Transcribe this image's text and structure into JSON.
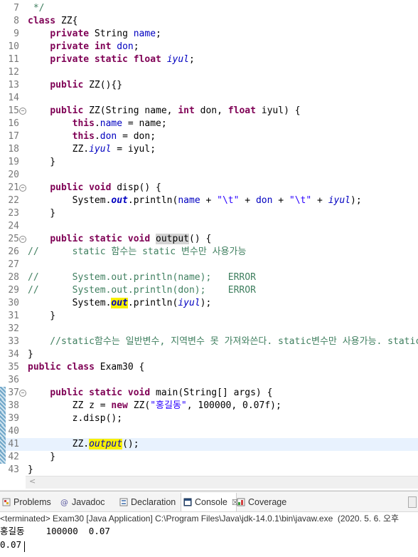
{
  "editor": {
    "lines": [
      {
        "num": "7",
        "fold": false,
        "mark": false,
        "hl": false,
        "segs": [
          {
            "t": " */",
            "c": "cmt"
          }
        ]
      },
      {
        "num": "8",
        "fold": false,
        "mark": false,
        "hl": false,
        "segs": [
          {
            "t": "class",
            "c": "kw"
          },
          {
            "t": " ZZ{"
          }
        ]
      },
      {
        "num": "9",
        "fold": false,
        "mark": false,
        "hl": false,
        "segs": [
          {
            "t": "    "
          },
          {
            "t": "private",
            "c": "kw"
          },
          {
            "t": " String "
          },
          {
            "t": "name",
            "c": "fld"
          },
          {
            "t": ";"
          }
        ]
      },
      {
        "num": "10",
        "fold": false,
        "mark": false,
        "hl": false,
        "segs": [
          {
            "t": "    "
          },
          {
            "t": "private",
            "c": "kw"
          },
          {
            "t": " "
          },
          {
            "t": "int",
            "c": "kw"
          },
          {
            "t": " "
          },
          {
            "t": "don",
            "c": "fld"
          },
          {
            "t": ";"
          }
        ]
      },
      {
        "num": "11",
        "fold": false,
        "mark": false,
        "hl": false,
        "segs": [
          {
            "t": "    "
          },
          {
            "t": "private static float",
            "c": "kw"
          },
          {
            "t": " "
          },
          {
            "t": "iyul",
            "c": "sfl"
          },
          {
            "t": ";"
          }
        ]
      },
      {
        "num": "12",
        "fold": false,
        "mark": false,
        "hl": false,
        "segs": []
      },
      {
        "num": "13",
        "fold": false,
        "mark": false,
        "hl": false,
        "segs": [
          {
            "t": "    "
          },
          {
            "t": "public",
            "c": "kw"
          },
          {
            "t": " ZZ(){}"
          }
        ]
      },
      {
        "num": "14",
        "fold": false,
        "mark": false,
        "hl": false,
        "segs": []
      },
      {
        "num": "15",
        "fold": true,
        "mark": false,
        "hl": false,
        "segs": [
          {
            "t": "    "
          },
          {
            "t": "public",
            "c": "kw"
          },
          {
            "t": " ZZ(String name, "
          },
          {
            "t": "int",
            "c": "kw"
          },
          {
            "t": " don, "
          },
          {
            "t": "float",
            "c": "kw"
          },
          {
            "t": " iyul) {"
          }
        ]
      },
      {
        "num": "16",
        "fold": false,
        "mark": false,
        "hl": false,
        "segs": [
          {
            "t": "        "
          },
          {
            "t": "this",
            "c": "kw"
          },
          {
            "t": "."
          },
          {
            "t": "name",
            "c": "fld"
          },
          {
            "t": " = name;"
          }
        ]
      },
      {
        "num": "17",
        "fold": false,
        "mark": false,
        "hl": false,
        "segs": [
          {
            "t": "        "
          },
          {
            "t": "this",
            "c": "kw"
          },
          {
            "t": "."
          },
          {
            "t": "don",
            "c": "fld"
          },
          {
            "t": " = don;"
          }
        ]
      },
      {
        "num": "18",
        "fold": false,
        "mark": false,
        "hl": false,
        "segs": [
          {
            "t": "        ZZ."
          },
          {
            "t": "iyul",
            "c": "sfl"
          },
          {
            "t": " = iyul;"
          }
        ]
      },
      {
        "num": "19",
        "fold": false,
        "mark": false,
        "hl": false,
        "segs": [
          {
            "t": "    }"
          }
        ]
      },
      {
        "num": "20",
        "fold": false,
        "mark": false,
        "hl": false,
        "segs": []
      },
      {
        "num": "21",
        "fold": true,
        "mark": false,
        "hl": false,
        "segs": [
          {
            "t": "    "
          },
          {
            "t": "public void",
            "c": "kw"
          },
          {
            "t": " disp() {"
          }
        ]
      },
      {
        "num": "22",
        "fold": false,
        "mark": false,
        "hl": false,
        "segs": [
          {
            "t": "        System."
          },
          {
            "t": "out",
            "c": "out"
          },
          {
            "t": ".println("
          },
          {
            "t": "name",
            "c": "fld"
          },
          {
            "t": " + "
          },
          {
            "t": "\"\\t\"",
            "c": "str"
          },
          {
            "t": " + "
          },
          {
            "t": "don",
            "c": "fld"
          },
          {
            "t": " + "
          },
          {
            "t": "\"\\t\"",
            "c": "str"
          },
          {
            "t": " + "
          },
          {
            "t": "iyul",
            "c": "sfl"
          },
          {
            "t": ");"
          }
        ]
      },
      {
        "num": "23",
        "fold": false,
        "mark": false,
        "hl": false,
        "segs": [
          {
            "t": "    }"
          }
        ]
      },
      {
        "num": "24",
        "fold": false,
        "mark": false,
        "hl": false,
        "segs": []
      },
      {
        "num": "25",
        "fold": true,
        "mark": false,
        "hl": false,
        "segs": [
          {
            "t": "    "
          },
          {
            "t": "public static void",
            "c": "kw"
          },
          {
            "t": " "
          },
          {
            "t": "output",
            "c": "ghl"
          },
          {
            "t": "() {"
          }
        ]
      },
      {
        "num": "26",
        "fold": false,
        "mark": false,
        "hl": false,
        "segs": [
          {
            "t": "//      static 함수는 static 변수만 사용가능",
            "c": "cmt"
          }
        ]
      },
      {
        "num": "27",
        "fold": false,
        "mark": false,
        "hl": false,
        "segs": []
      },
      {
        "num": "28",
        "fold": false,
        "mark": false,
        "hl": false,
        "segs": [
          {
            "t": "//      System.out.println(name);   ERROR",
            "c": "cmt"
          }
        ]
      },
      {
        "num": "29",
        "fold": false,
        "mark": false,
        "hl": false,
        "segs": [
          {
            "t": "//      System.out.println(don);    ERROR",
            "c": "cmt"
          }
        ]
      },
      {
        "num": "30",
        "fold": false,
        "mark": false,
        "hl": false,
        "segs": [
          {
            "t": "        System."
          },
          {
            "t": "out",
            "c": "out yhl"
          },
          {
            "t": ".println("
          },
          {
            "t": "iyul",
            "c": "sfl"
          },
          {
            "t": ");"
          }
        ]
      },
      {
        "num": "31",
        "fold": false,
        "mark": false,
        "hl": false,
        "segs": [
          {
            "t": "    }"
          }
        ]
      },
      {
        "num": "32",
        "fold": false,
        "mark": false,
        "hl": false,
        "segs": []
      },
      {
        "num": "33",
        "fold": false,
        "mark": false,
        "hl": false,
        "segs": [
          {
            "t": "    //static함수는 일반변수, 지역변수 못 가져와쓴다. static변수만 사용가능. static변수는",
            "c": "cmt"
          }
        ]
      },
      {
        "num": "34",
        "fold": false,
        "mark": false,
        "hl": false,
        "segs": [
          {
            "t": "}"
          }
        ]
      },
      {
        "num": "35",
        "fold": false,
        "mark": false,
        "hl": false,
        "segs": [
          {
            "t": "public class",
            "c": "kw"
          },
          {
            "t": " Exam30 {"
          }
        ]
      },
      {
        "num": "36",
        "fold": false,
        "mark": false,
        "hl": false,
        "segs": []
      },
      {
        "num": "37",
        "fold": true,
        "mark": true,
        "hl": false,
        "segs": [
          {
            "t": "    "
          },
          {
            "t": "public static void",
            "c": "kw"
          },
          {
            "t": " main(String[] args) {"
          }
        ]
      },
      {
        "num": "38",
        "fold": false,
        "mark": true,
        "hl": false,
        "segs": [
          {
            "t": "        ZZ z = "
          },
          {
            "t": "new",
            "c": "kw"
          },
          {
            "t": " ZZ("
          },
          {
            "t": "\"홍길동\"",
            "c": "str"
          },
          {
            "t": ", 100000, 0.07f);"
          }
        ]
      },
      {
        "num": "39",
        "fold": false,
        "mark": true,
        "hl": false,
        "segs": [
          {
            "t": "        z.disp();"
          }
        ]
      },
      {
        "num": "40",
        "fold": false,
        "mark": true,
        "hl": false,
        "segs": []
      },
      {
        "num": "41",
        "fold": false,
        "mark": true,
        "hl": true,
        "segs": [
          {
            "t": "        ZZ."
          },
          {
            "t": "output",
            "c": "sfl yhl"
          },
          {
            "t": "();"
          }
        ]
      },
      {
        "num": "42",
        "fold": false,
        "mark": true,
        "hl": false,
        "segs": [
          {
            "t": "    }"
          }
        ]
      },
      {
        "num": "43",
        "fold": false,
        "mark": false,
        "hl": false,
        "segs": [
          {
            "t": "}"
          }
        ]
      }
    ],
    "scroll_arrow": "<"
  },
  "views": {
    "tabs": [
      {
        "name": "problems",
        "label": "Problems",
        "icon": "problems-icon",
        "active": false
      },
      {
        "name": "javadoc",
        "label": "Javadoc",
        "icon": "javadoc-icon",
        "active": false
      },
      {
        "name": "declaration",
        "label": "Declaration",
        "icon": "declaration-icon",
        "active": false
      },
      {
        "name": "console",
        "label": "Console",
        "icon": "console-icon",
        "active": true
      },
      {
        "name": "coverage",
        "label": "Coverage",
        "icon": "coverage-icon",
        "active": false
      }
    ],
    "close_glyph": "☒"
  },
  "console": {
    "status": "<terminated> Exam30 [Java Application] C:\\Program Files\\Java\\jdk-14.0.1\\bin\\javaw.exe  (2020. 5. 6. 오후",
    "output": [
      "홍길동    100000  0.07",
      "0.07"
    ]
  },
  "colors": {
    "keyword": "#7f0055",
    "field": "#0000c0",
    "string": "#2a00ff",
    "comment": "#3f7f5f",
    "occurrence_highlight": "#f8f000",
    "current_line": "#e8f2fe"
  }
}
